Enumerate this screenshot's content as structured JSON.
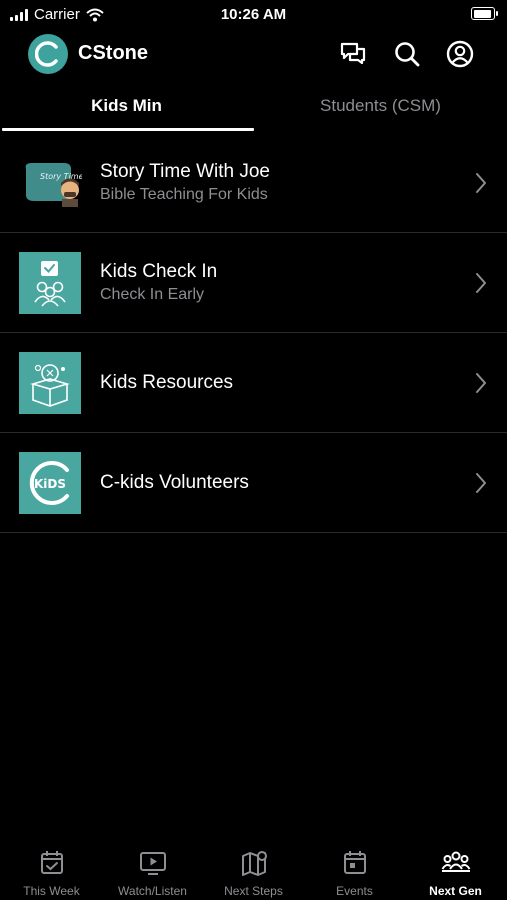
{
  "status_bar": {
    "carrier": "Carrier",
    "time": "10:26 AM"
  },
  "header": {
    "app_name": "CStone",
    "logo_text": "C"
  },
  "tabs": [
    {
      "label": "Kids Min",
      "active": true
    },
    {
      "label": "Students (CSM)",
      "active": false
    }
  ],
  "list": [
    {
      "title": "Story Time With Joe",
      "subtitle": "Bible Teaching For Kids",
      "thumb_text": "Story Time!",
      "icon": "story-time-thumbnail"
    },
    {
      "title": "Kids Check In",
      "subtitle": "Check In Early",
      "icon": "check-in-thumbnail"
    },
    {
      "title": "Kids Resources",
      "subtitle": "",
      "icon": "resources-thumbnail"
    },
    {
      "title": "C-kids Volunteers",
      "subtitle": "",
      "thumb_text": "KiDS",
      "icon": "c-kids-logo-thumbnail"
    }
  ],
  "tabbar": [
    {
      "label": "This Week",
      "icon": "calendar-check-icon",
      "active": false
    },
    {
      "label": "Watch/Listen",
      "icon": "play-screen-icon",
      "active": false
    },
    {
      "label": "Next Steps",
      "icon": "map-pin-icon",
      "active": false
    },
    {
      "label": "Events",
      "icon": "calendar-icon",
      "active": false
    },
    {
      "label": "Next Gen",
      "icon": "group-icon",
      "active": true
    }
  ],
  "colors": {
    "accent": "#4aa7a0",
    "background": "#000000",
    "muted": "#8e8e93"
  }
}
